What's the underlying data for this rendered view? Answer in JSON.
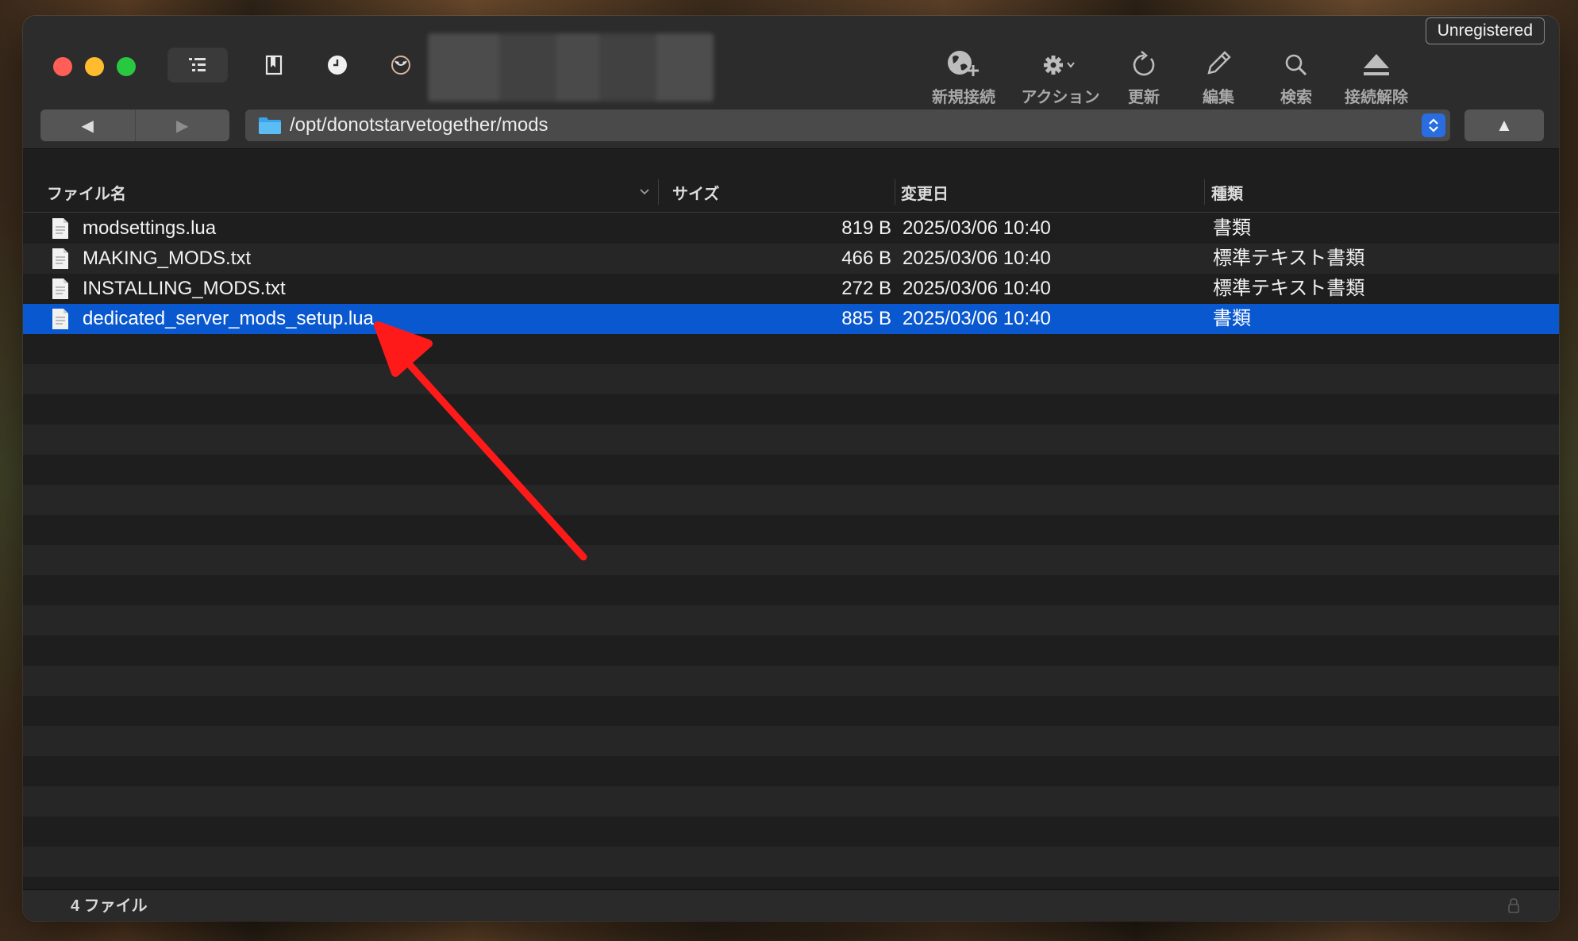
{
  "window": {
    "unregistered_label": "Unregistered"
  },
  "toolbar": {
    "actions": [
      {
        "name": "new-connection",
        "label": "新規接続",
        "icon": "globe-plus-icon"
      },
      {
        "name": "action",
        "label": "アクション",
        "icon": "gear-icon"
      },
      {
        "name": "refresh",
        "label": "更新",
        "icon": "refresh-icon"
      },
      {
        "name": "edit",
        "label": "編集",
        "icon": "pencil-icon"
      },
      {
        "name": "search",
        "label": "検索",
        "icon": "search-icon"
      },
      {
        "name": "disconnect",
        "label": "接続解除",
        "icon": "eject-icon"
      }
    ]
  },
  "nav": {
    "back_glyph": "◀",
    "forward_glyph": "▶",
    "up_glyph": "▲"
  },
  "pathbar": {
    "path": "/opt/donotstarvetogether/mods"
  },
  "columns": {
    "name": "ファイル名",
    "size": "サイズ",
    "date": "変更日",
    "kind": "種類"
  },
  "files": [
    {
      "name": "modsettings.lua",
      "size": "819 B",
      "date": "2025/03/06 10:40",
      "kind": "書類",
      "selected": false
    },
    {
      "name": "MAKING_MODS.txt",
      "size": "466 B",
      "date": "2025/03/06 10:40",
      "kind": "標準テキスト書類",
      "selected": false
    },
    {
      "name": "INSTALLING_MODS.txt",
      "size": "272 B",
      "date": "2025/03/06 10:40",
      "kind": "標準テキスト書類",
      "selected": false
    },
    {
      "name": "dedicated_server_mods_setup.lua",
      "size": "885 B",
      "date": "2025/03/06 10:40",
      "kind": "書類",
      "selected": true
    }
  ],
  "status": {
    "count": "4 ファイル"
  },
  "colors": {
    "selection": "#0a58d0",
    "annotation_arrow": "#ff1a1a"
  }
}
